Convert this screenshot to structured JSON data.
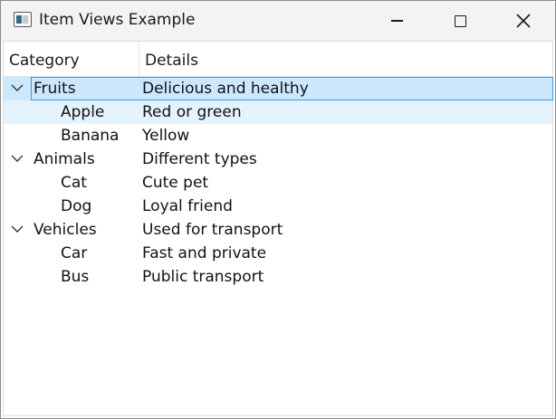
{
  "window": {
    "title": "Item Views Example"
  },
  "icons": {
    "app": "window-app-icon",
    "minimize": "minimize-icon",
    "maximize": "maximize-icon",
    "close": "close-icon",
    "expand": "chevron-down-icon"
  },
  "colors": {
    "selection_fill": "#cce8ff",
    "selection_border": "#3a9bd9",
    "hover_fill": "#e5f3ff"
  },
  "tree": {
    "columns": [
      "Category",
      "Details"
    ],
    "rows": [
      {
        "category": "Fruits",
        "details": "Delicious and healthy",
        "level": 0,
        "expanded": true,
        "state": "selected"
      },
      {
        "category": "Apple",
        "details": "Red or green",
        "level": 1,
        "state": "hover"
      },
      {
        "category": "Banana",
        "details": "Yellow",
        "level": 1,
        "state": "normal"
      },
      {
        "category": "Animals",
        "details": "Different types",
        "level": 0,
        "expanded": true,
        "state": "normal"
      },
      {
        "category": "Cat",
        "details": "Cute pet",
        "level": 1,
        "state": "normal"
      },
      {
        "category": "Dog",
        "details": "Loyal friend",
        "level": 1,
        "state": "normal"
      },
      {
        "category": "Vehicles",
        "details": "Used for transport",
        "level": 0,
        "expanded": true,
        "state": "normal"
      },
      {
        "category": "Car",
        "details": "Fast and private",
        "level": 1,
        "state": "normal"
      },
      {
        "category": "Bus",
        "details": "Public transport",
        "level": 1,
        "state": "normal"
      }
    ]
  }
}
